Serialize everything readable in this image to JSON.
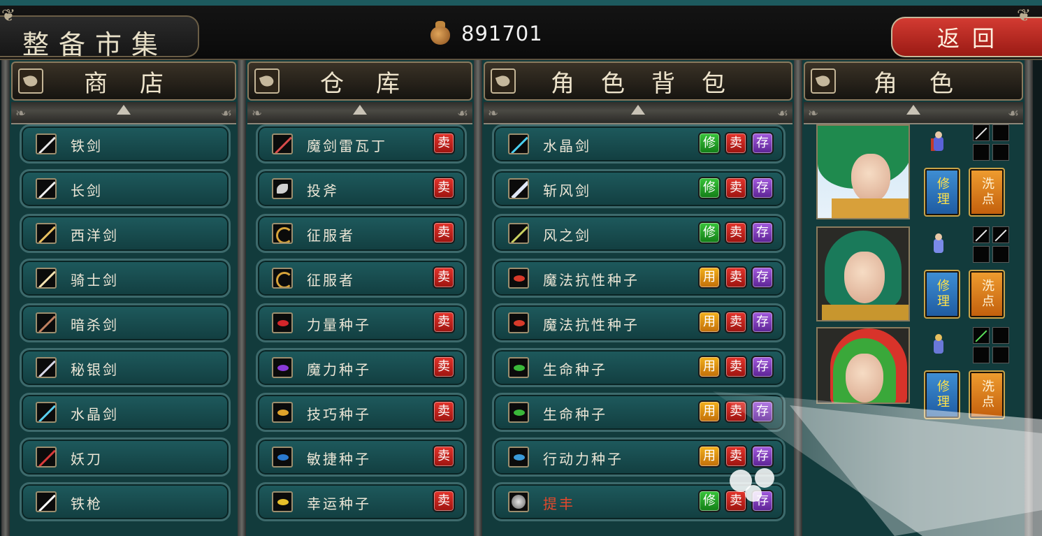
{
  "header": {
    "title": "整备市集",
    "money": "891701",
    "back_label": "返回",
    "money_icon": "money-bag-icon"
  },
  "columns": {
    "shop": "商店",
    "storage": "仓库",
    "bag": "角色背包",
    "role": "角色"
  },
  "shop_items": [
    {
      "name": "铁剑",
      "icon": "sword-icon"
    },
    {
      "name": "长剑",
      "icon": "sword-icon"
    },
    {
      "name": "西洋剑",
      "icon": "rapier-icon"
    },
    {
      "name": "骑士剑",
      "icon": "sword-icon"
    },
    {
      "name": "暗杀剑",
      "icon": "dagger-icon"
    },
    {
      "name": "秘银剑",
      "icon": "sword-icon"
    },
    {
      "name": "水晶剑",
      "icon": "crystal-sword-icon"
    },
    {
      "name": "妖刀",
      "icon": "demon-blade-icon"
    },
    {
      "name": "铁枪",
      "icon": "spear-icon"
    }
  ],
  "storage_items": [
    {
      "name": "魔剑雷瓦丁",
      "icon": "demon-sword-icon",
      "sell": "卖"
    },
    {
      "name": "投斧",
      "icon": "axe-icon",
      "sell": "卖"
    },
    {
      "name": "征服者",
      "icon": "conqueror-icon",
      "sell": "卖"
    },
    {
      "name": "征服者",
      "icon": "conqueror-icon",
      "sell": "卖"
    },
    {
      "name": "力量种子",
      "icon": "seed-icon",
      "sell": "卖"
    },
    {
      "name": "魔力种子",
      "icon": "seed-icon",
      "sell": "卖"
    },
    {
      "name": "技巧种子",
      "icon": "seed-icon",
      "sell": "卖"
    },
    {
      "name": "敏捷种子",
      "icon": "seed-icon",
      "sell": "卖"
    },
    {
      "name": "幸运种子",
      "icon": "seed-icon",
      "sell": "卖"
    }
  ],
  "bag_items": [
    {
      "name": "水晶剑",
      "action": "修",
      "sell": "卖",
      "store": "存",
      "red": false
    },
    {
      "name": "斩风剑",
      "action": "修",
      "sell": "卖",
      "store": "存",
      "red": false
    },
    {
      "name": "风之剑",
      "action": "修",
      "sell": "卖",
      "store": "存",
      "red": false
    },
    {
      "name": "魔法抗性种子",
      "action": "用",
      "sell": "卖",
      "store": "存",
      "red": false
    },
    {
      "name": "魔法抗性种子",
      "action": "用",
      "sell": "卖",
      "store": "存",
      "red": false
    },
    {
      "name": "生命种子",
      "action": "用",
      "sell": "卖",
      "store": "存",
      "red": false
    },
    {
      "name": "生命种子",
      "action": "用",
      "sell": "卖",
      "store": "存",
      "red": false
    },
    {
      "name": "行动力种子",
      "action": "用",
      "sell": "卖",
      "store": "存",
      "red": false
    },
    {
      "name": "提丰",
      "action": "修",
      "sell": "卖",
      "store": "存",
      "red": true
    }
  ],
  "characters": [
    {
      "fix": "修理",
      "wash": "洗点"
    },
    {
      "fix": "修理",
      "wash": "洗点"
    },
    {
      "fix": "修理",
      "wash": "洗点"
    }
  ],
  "colors": {
    "repair_button": "#2a9a2c",
    "use_button": "#e89a14",
    "sell_button": "#c41e1a",
    "store_button": "#7a3ab8",
    "back_button": "#c42a22",
    "row_bg": "#1a4f52"
  }
}
